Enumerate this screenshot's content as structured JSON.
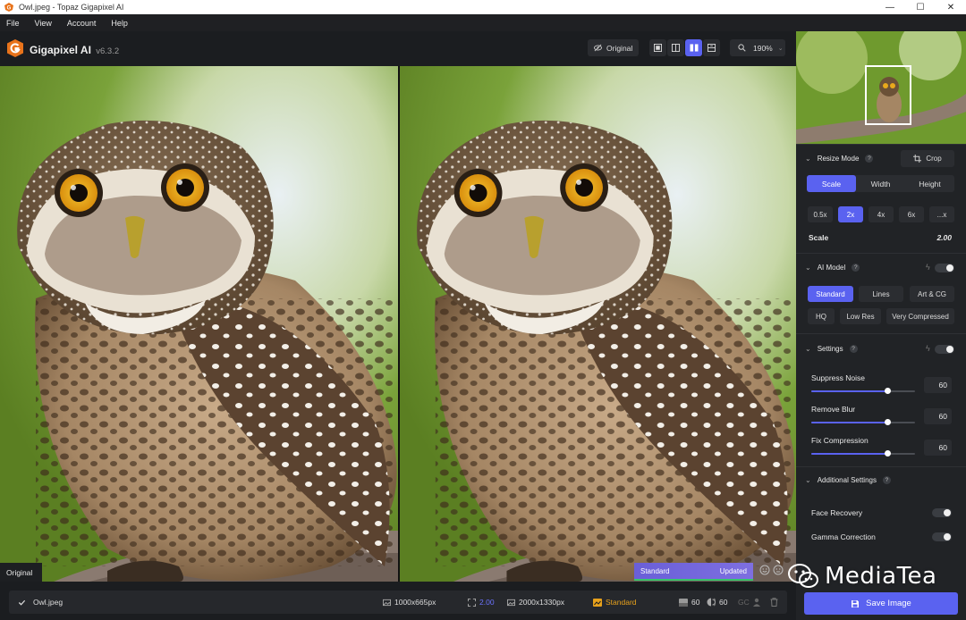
{
  "window": {
    "title": "Owl.jpeg - Topaz Gigapixel AI",
    "min_glyph": "—",
    "max_glyph": "☐",
    "close_glyph": "✕"
  },
  "menu": [
    "File",
    "View",
    "Account",
    "Help"
  ],
  "toolbar": {
    "brand": "Gigapixel AI",
    "version": "v6.3.2",
    "original_label": "Original",
    "zoom_value": "190%",
    "active_view": "side-by-side"
  },
  "preview": {
    "original_label": "Original",
    "status_model": "Standard",
    "status_state": "Updated"
  },
  "sidebar": {
    "resize_mode": {
      "label": "Resize Mode",
      "crop_label": "Crop",
      "tabs": [
        "Scale",
        "Width",
        "Height"
      ],
      "active_tab": "Scale",
      "scale_options": [
        "0.5x",
        "2x",
        "4x",
        "6x",
        "...x"
      ],
      "active_scale": "2x",
      "scale_label": "Scale",
      "scale_value": "2.00"
    },
    "ai_model": {
      "label": "AI Model",
      "models": [
        "Standard",
        "Lines",
        "Art & CG",
        "HQ",
        "Low Res",
        "Very Compressed"
      ],
      "active_model": "Standard"
    },
    "settings": {
      "label": "Settings",
      "sliders": [
        {
          "label": "Suppress Noise",
          "value": "60",
          "level": 0.6
        },
        {
          "label": "Remove Blur",
          "value": "60",
          "level": 0.6
        },
        {
          "label": "Fix Compression",
          "value": "60",
          "level": 0.6
        }
      ]
    },
    "additional": {
      "label": "Additional Settings",
      "face_recovery": "Face Recovery",
      "gamma_correction": "Gamma Correction"
    },
    "save_label": "Save Image"
  },
  "filebar": {
    "filename": "Owl.jpeg",
    "input_size": "1000x665px",
    "scale": "2.00",
    "output_size": "2000x1330px",
    "model": "Standard",
    "noise": "60",
    "blur": "60",
    "gc": "GC"
  },
  "watermark": "MediaTea",
  "colors": {
    "accent": "#5a62f0",
    "gold": "#e7a11c",
    "updated_green": "#36c46a"
  }
}
